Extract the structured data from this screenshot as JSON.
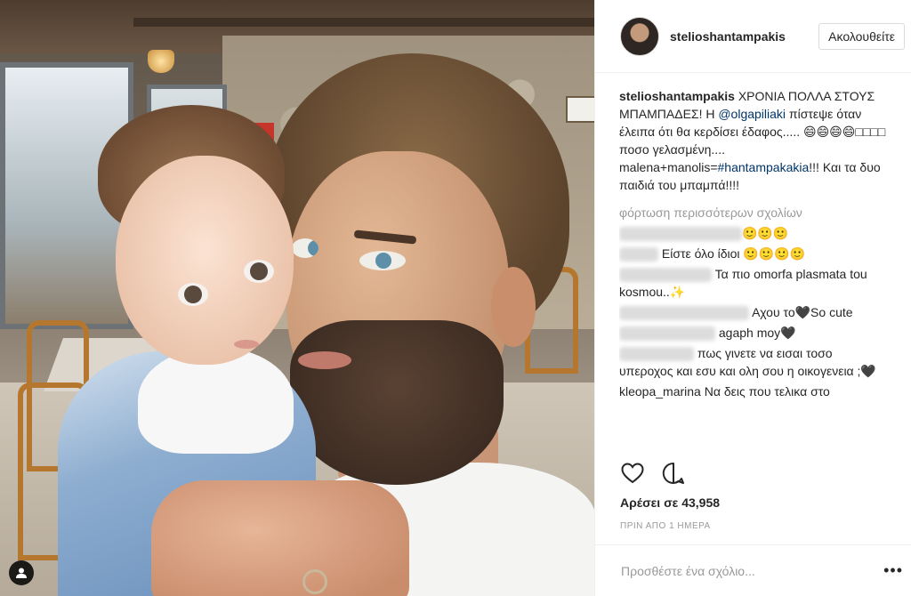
{
  "post": {
    "username": "stelioshantampakis",
    "follow_label": "Ακολουθείτε",
    "caption": {
      "username": "stelioshantampakis",
      "text_1": " ΧΡΟΝΙΑ ΠΟΛΛΑ ΣΤΟΥΣ ΜΠΑΜΠΑΔΕΣ! Η ",
      "mention": "@olgapiliaki",
      "text_2": " πίστεψε όταν έλειπα ότι θα κερδίσει έδαφος..... 😄😄😄😄□□□□ ποσο γελασμένη.... malena+manolis=",
      "hashtag": "#hantampakakia",
      "text_3": "!!! Και τα δυο παιδιά του μπαμπά!!!!"
    },
    "load_more": "φόρτωση περισσότερων σχολίων",
    "comments": [
      {
        "text": "🙂🙂🙂"
      },
      {
        "text": " Είστε όλο ίδιοι 🙂🙂🙂🙂"
      },
      {
        "text": " Τα πιο omorfa plasmata tou kosmou..✨"
      },
      {
        "text": " Αχου το🖤So cute"
      },
      {
        "text": " agaph moy🖤"
      },
      {
        "text": " πως γινετε να εισαι τοσο υπεροχος και εσυ και ολη σου η οικογενεια ;🖤"
      },
      {
        "text": "kleopa_marina Να δεις που τελικα στο"
      }
    ],
    "likes": "Αρέσει σε 43,958",
    "time": "ΠΡΙΝ ΑΠΟ 1 ΗΜΕΡΑ",
    "add_comment_placeholder": "Προσθέστε ένα σχόλιο...",
    "more_label": "•••"
  }
}
